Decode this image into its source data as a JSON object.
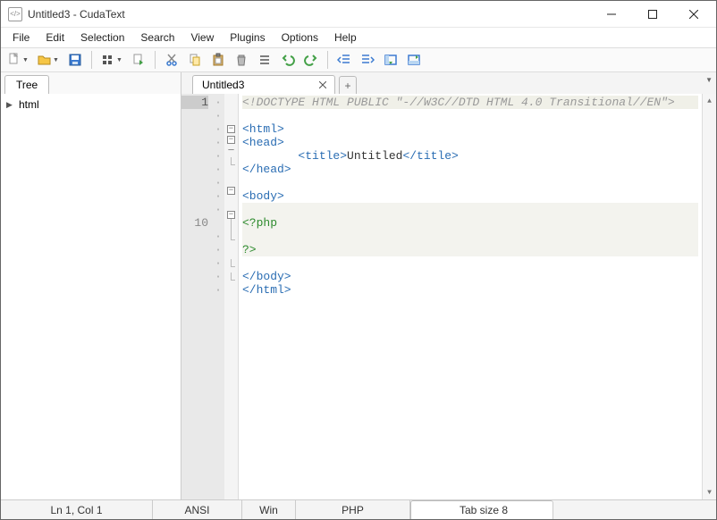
{
  "window": {
    "title": "Untitled3 - CudaText",
    "app_icon_label": "</>"
  },
  "menu": [
    "File",
    "Edit",
    "Selection",
    "Search",
    "View",
    "Plugins",
    "Options",
    "Help"
  ],
  "toolbar_icons": [
    "new-file-icon",
    "open-file-icon",
    "save-icon",
    "recent-icon",
    "reopen-icon",
    "cut-icon",
    "copy-icon",
    "paste-icon",
    "delete-icon",
    "select-all-icon",
    "undo-icon",
    "redo-icon",
    "unindent-icon",
    "indent-icon",
    "show-panel-icon",
    "show-side-icon"
  ],
  "sidebar": {
    "tab_label": "Tree",
    "items": [
      {
        "label": "html",
        "expandable": true
      }
    ]
  },
  "tabs": {
    "active": {
      "label": "Untitled3"
    },
    "add_label": "+"
  },
  "editor": {
    "visible_line_number_first": "1",
    "visible_line_number_php": "10",
    "lines": [
      {
        "type": "doctype",
        "text": "<!DOCTYPE HTML PUBLIC \"-//W3C//DTD HTML 4.0 Transitional//EN\">"
      },
      {
        "type": "blank",
        "text": ""
      },
      {
        "type": "tag",
        "text": "<html>"
      },
      {
        "type": "tag",
        "text": "<head>"
      },
      {
        "type": "title",
        "indent": "        ",
        "open": "<title>",
        "content": "Untitled",
        "close": "</title>"
      },
      {
        "type": "tag",
        "text": "</head>"
      },
      {
        "type": "blank",
        "text": ""
      },
      {
        "type": "tag",
        "text": "<body>"
      },
      {
        "type": "blank",
        "text": ""
      },
      {
        "type": "php",
        "text": "<?php"
      },
      {
        "type": "php-blank",
        "text": ""
      },
      {
        "type": "php",
        "text": "?>"
      },
      {
        "type": "blank",
        "text": ""
      },
      {
        "type": "tag",
        "text": "</body>"
      },
      {
        "type": "tag",
        "text": "</html>"
      }
    ]
  },
  "status": {
    "position": "Ln 1, Col 1",
    "encoding": "ANSI",
    "eol": "Win",
    "language": "PHP",
    "tabsize": "Tab size 8"
  }
}
